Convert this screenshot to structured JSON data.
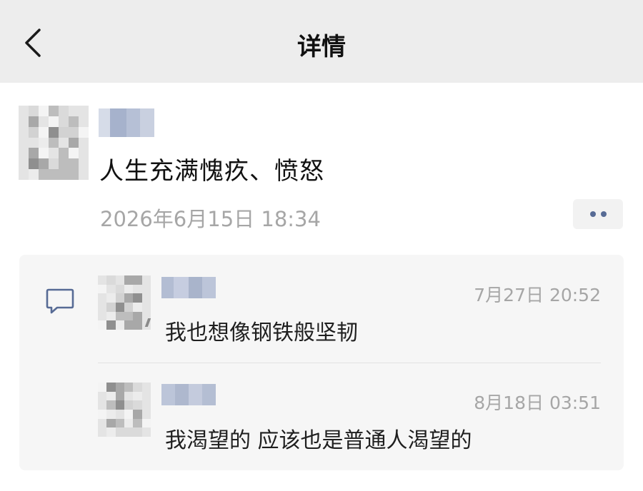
{
  "header": {
    "title": "详情",
    "back_icon": "chevron-left-icon"
  },
  "post": {
    "author_blurred": true,
    "text": "人生充满愧疚、愤怒",
    "timestamp": "2026年6月15日 18:34",
    "more_icon": "more-dots-icon"
  },
  "comments": [
    {
      "author_blurred": true,
      "time": "7月27日 20:52",
      "text": "我也想像钢铁般坚韧"
    },
    {
      "author_blurred": true,
      "time": "8月18日 03:51",
      "text": "我渴望的 应该也是普通人渴望的"
    }
  ],
  "colors": {
    "header_bg": "#ededed",
    "link_blue": "#576b95",
    "time_gray": "#a6a6a6",
    "comment_bg": "#f6f6f6"
  }
}
